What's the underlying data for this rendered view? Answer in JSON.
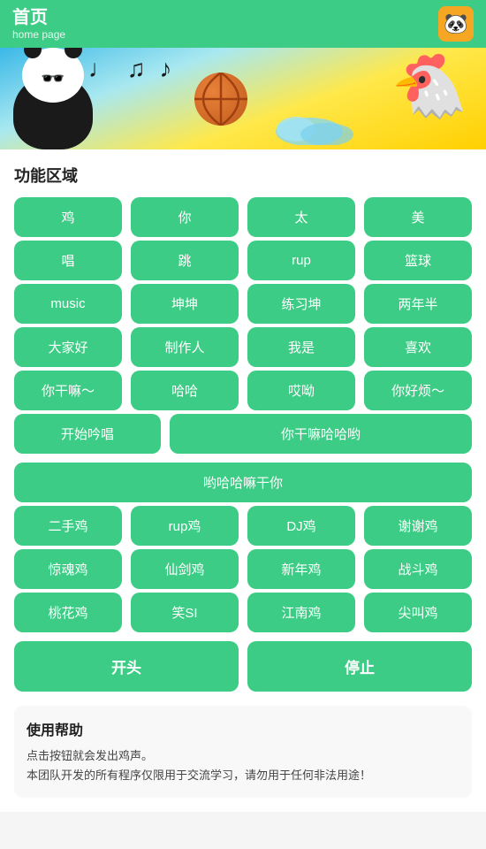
{
  "header": {
    "title_zh": "首页",
    "title_en": "home page",
    "avatar_emoji": "🐼"
  },
  "banner": {
    "notes": "♩ ♫ ♪"
  },
  "functions": {
    "section_label": "功能区域",
    "row1": [
      "鸡",
      "你",
      "太",
      "美"
    ],
    "row2": [
      "唱",
      "跳",
      "rup",
      "篮球"
    ],
    "row3": [
      "music",
      "坤坤",
      "练习坤",
      "两年半"
    ],
    "row4": [
      "大家好",
      "制作人",
      "我是",
      "喜欢"
    ],
    "row5": [
      "你干嘛～",
      "哈哈",
      "哎呦",
      "你好烦～"
    ],
    "row6_wide": [
      "开始吟唱",
      "你干嘛哈哈哟",
      "哟哈哈嘛干你"
    ],
    "row7": [
      "二手鸡",
      "rup鸡",
      "DJ鸡",
      "谢谢鸡"
    ],
    "row8": [
      "惊魂鸡",
      "仙剑鸡",
      "新年鸡",
      "战斗鸡"
    ],
    "row9": [
      "桃花鸡",
      "笑SI",
      "江南鸡",
      "尖叫鸡"
    ],
    "start_label": "开头",
    "stop_label": "停止"
  },
  "help": {
    "title": "使用帮助",
    "line1": "点击按钮就会发出鸡声。",
    "line2": "本团队开发的所有程序仅限用于交流学习，请勿用于任何非法用途！"
  }
}
